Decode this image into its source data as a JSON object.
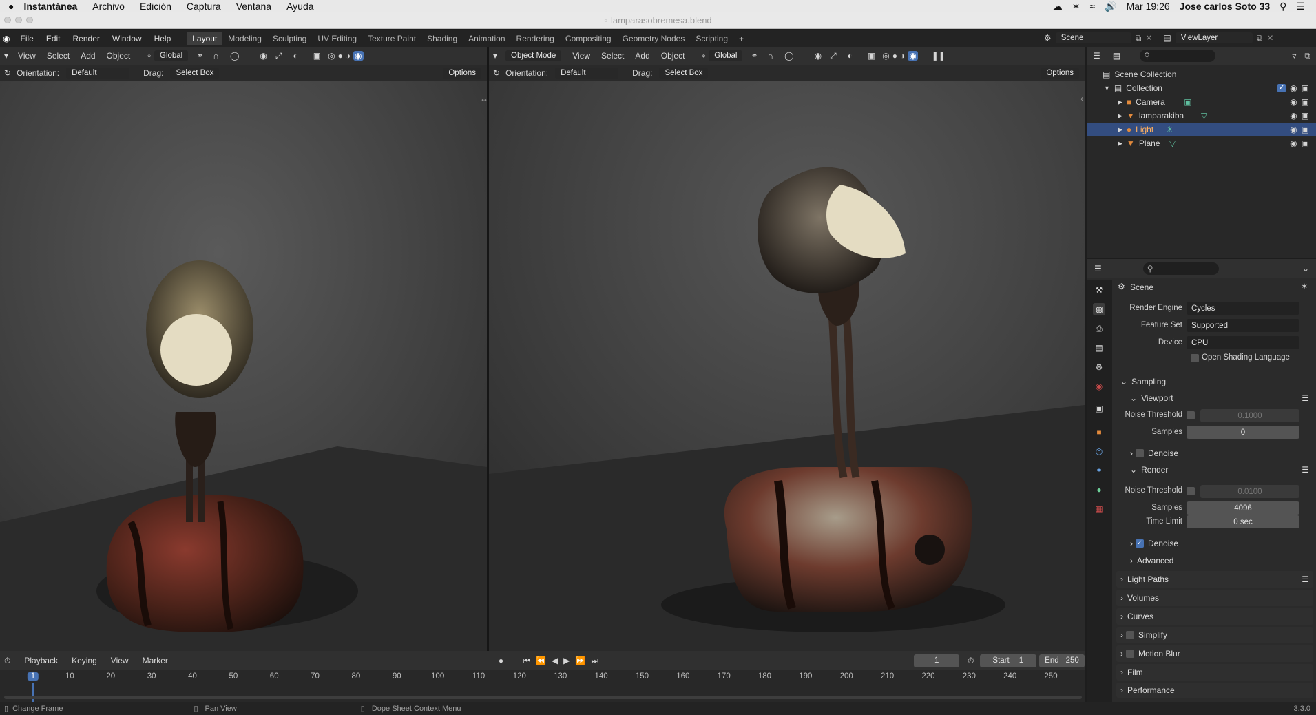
{
  "mac": {
    "app": "Instantánea",
    "menus": [
      "Archivo",
      "Edición",
      "Captura",
      "Ventana",
      "Ayuda"
    ],
    "clock": "Mar 19:26",
    "user": "Jose carlos Soto 33"
  },
  "window": {
    "title": "lamparasobremesa.blend"
  },
  "topbar": {
    "menus": [
      "File",
      "Edit",
      "Render",
      "Window",
      "Help"
    ],
    "workspaces": [
      "Layout",
      "Modeling",
      "Sculpting",
      "UV Editing",
      "Texture Paint",
      "Shading",
      "Animation",
      "Rendering",
      "Compositing",
      "Geometry Nodes",
      "Scripting"
    ],
    "active_workspace": "Layout",
    "add_tab": "+",
    "scene": "Scene",
    "viewlayer": "ViewLayer"
  },
  "left_view": {
    "menus": [
      "View",
      "Select",
      "Add",
      "Object"
    ],
    "transform": "Global",
    "orientation_label": "Orientation:",
    "orientation": "Default",
    "drag_label": "Drag:",
    "drag": "Select Box",
    "options": "Options"
  },
  "right_view": {
    "mode": "Object Mode",
    "menus": [
      "View",
      "Select",
      "Add",
      "Object"
    ],
    "transform": "Global",
    "orientation_label": "Orientation:",
    "orientation": "Default",
    "drag_label": "Drag:",
    "drag": "Select Box",
    "options": "Options"
  },
  "outliner": {
    "root": "Scene Collection",
    "collection": "Collection",
    "items": [
      {
        "name": "Camera",
        "icon": "camera-icon",
        "color": "#e28a3c",
        "selected": false
      },
      {
        "name": "lamparakiba",
        "icon": "mesh-icon",
        "color": "#e28a3c",
        "selected": false
      },
      {
        "name": "Light",
        "icon": "light-icon",
        "color": "#e28a3c",
        "selected": true
      },
      {
        "name": "Plane",
        "icon": "mesh-icon",
        "color": "#e28a3c",
        "selected": false
      }
    ]
  },
  "properties": {
    "context": "Scene",
    "render_engine_label": "Render Engine",
    "render_engine": "Cycles",
    "feature_set_label": "Feature Set",
    "feature_set": "Supported",
    "device_label": "Device",
    "device": "CPU",
    "osl": "Open Shading Language",
    "sampling": "Sampling",
    "viewport": "Viewport",
    "vp_noise_label": "Noise Threshold",
    "vp_noise": "0.1000",
    "vp_samples_label": "Samples",
    "vp_samples": "0",
    "vp_denoise": "Denoise",
    "render": "Render",
    "r_noise_label": "Noise Threshold",
    "r_noise": "0.0100",
    "r_samples_label": "Samples",
    "r_samples": "4096",
    "time_limit_label": "Time Limit",
    "time_limit": "0 sec",
    "r_denoise": "Denoise",
    "advanced": "Advanced",
    "panels": [
      "Light Paths",
      "Volumes",
      "Curves",
      "Simplify",
      "Motion Blur",
      "Film",
      "Performance"
    ]
  },
  "timeline": {
    "menus": [
      "Playback",
      "Keying",
      "View",
      "Marker"
    ],
    "current_frame": "1",
    "start_label": "Start",
    "start": "1",
    "end_label": "End",
    "end": "250",
    "ticks": [
      "1",
      "10",
      "20",
      "30",
      "40",
      "50",
      "60",
      "70",
      "80",
      "90",
      "100",
      "110",
      "120",
      "130",
      "140",
      "150",
      "160",
      "170",
      "180",
      "190",
      "200",
      "210",
      "220",
      "230",
      "240",
      "250"
    ]
  },
  "status": {
    "change_frame": "Change Frame",
    "pan_view": "Pan View",
    "context_menu": "Dope Sheet Context Menu",
    "version": "3.3.0"
  },
  "colors": {
    "accent": "#4772b3",
    "selected_row": "#334d80",
    "object": "#e28a3c"
  }
}
